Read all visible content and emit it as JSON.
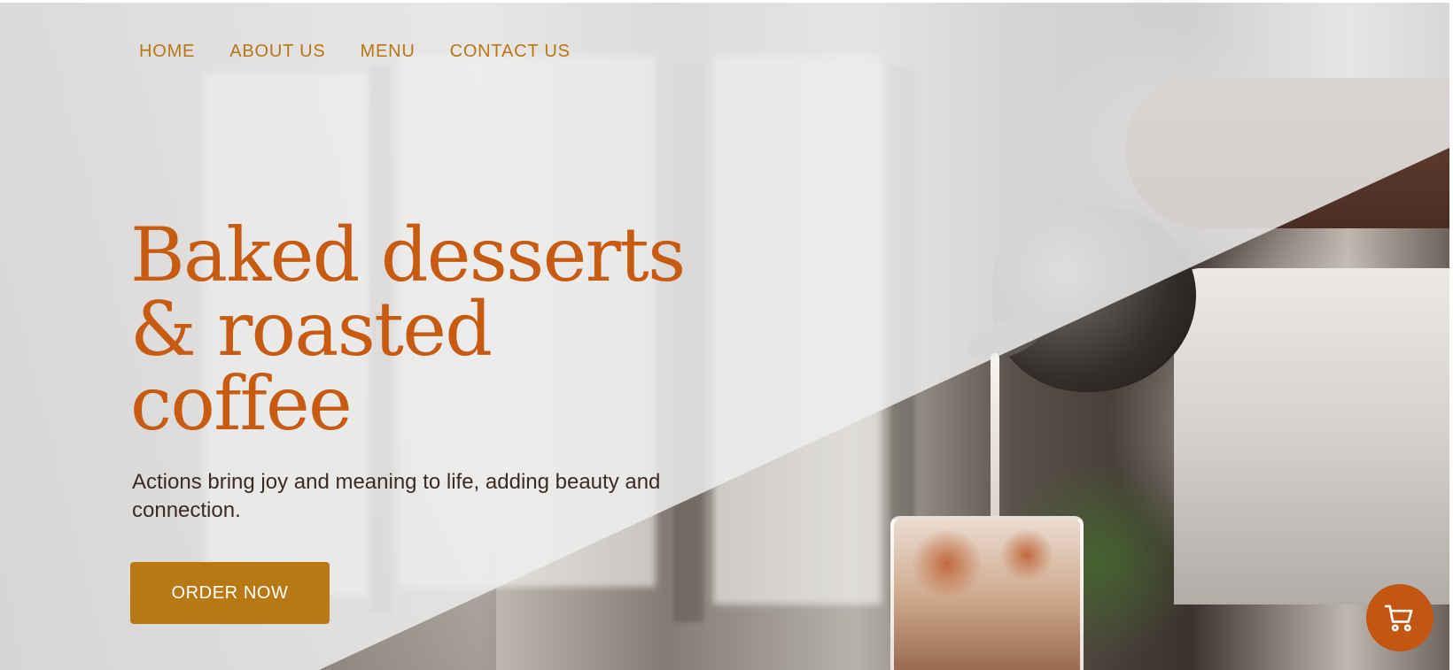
{
  "navigation": {
    "items": [
      {
        "label": "HOME"
      },
      {
        "label": "ABOUT US"
      },
      {
        "label": "MENU"
      },
      {
        "label": "CONTACT US"
      }
    ]
  },
  "hero": {
    "title": "Baked desserts\n& roasted coffee",
    "subtitle": "Actions bring joy and meaning to life, adding beauty and connection.",
    "cta_label": "ORDER NOW"
  },
  "cart": {
    "icon": "shopping-cart-icon"
  },
  "colors": {
    "nav_text": "#b77714",
    "title": "#c85b12",
    "button": "#b87914",
    "cart": "#c45613"
  }
}
